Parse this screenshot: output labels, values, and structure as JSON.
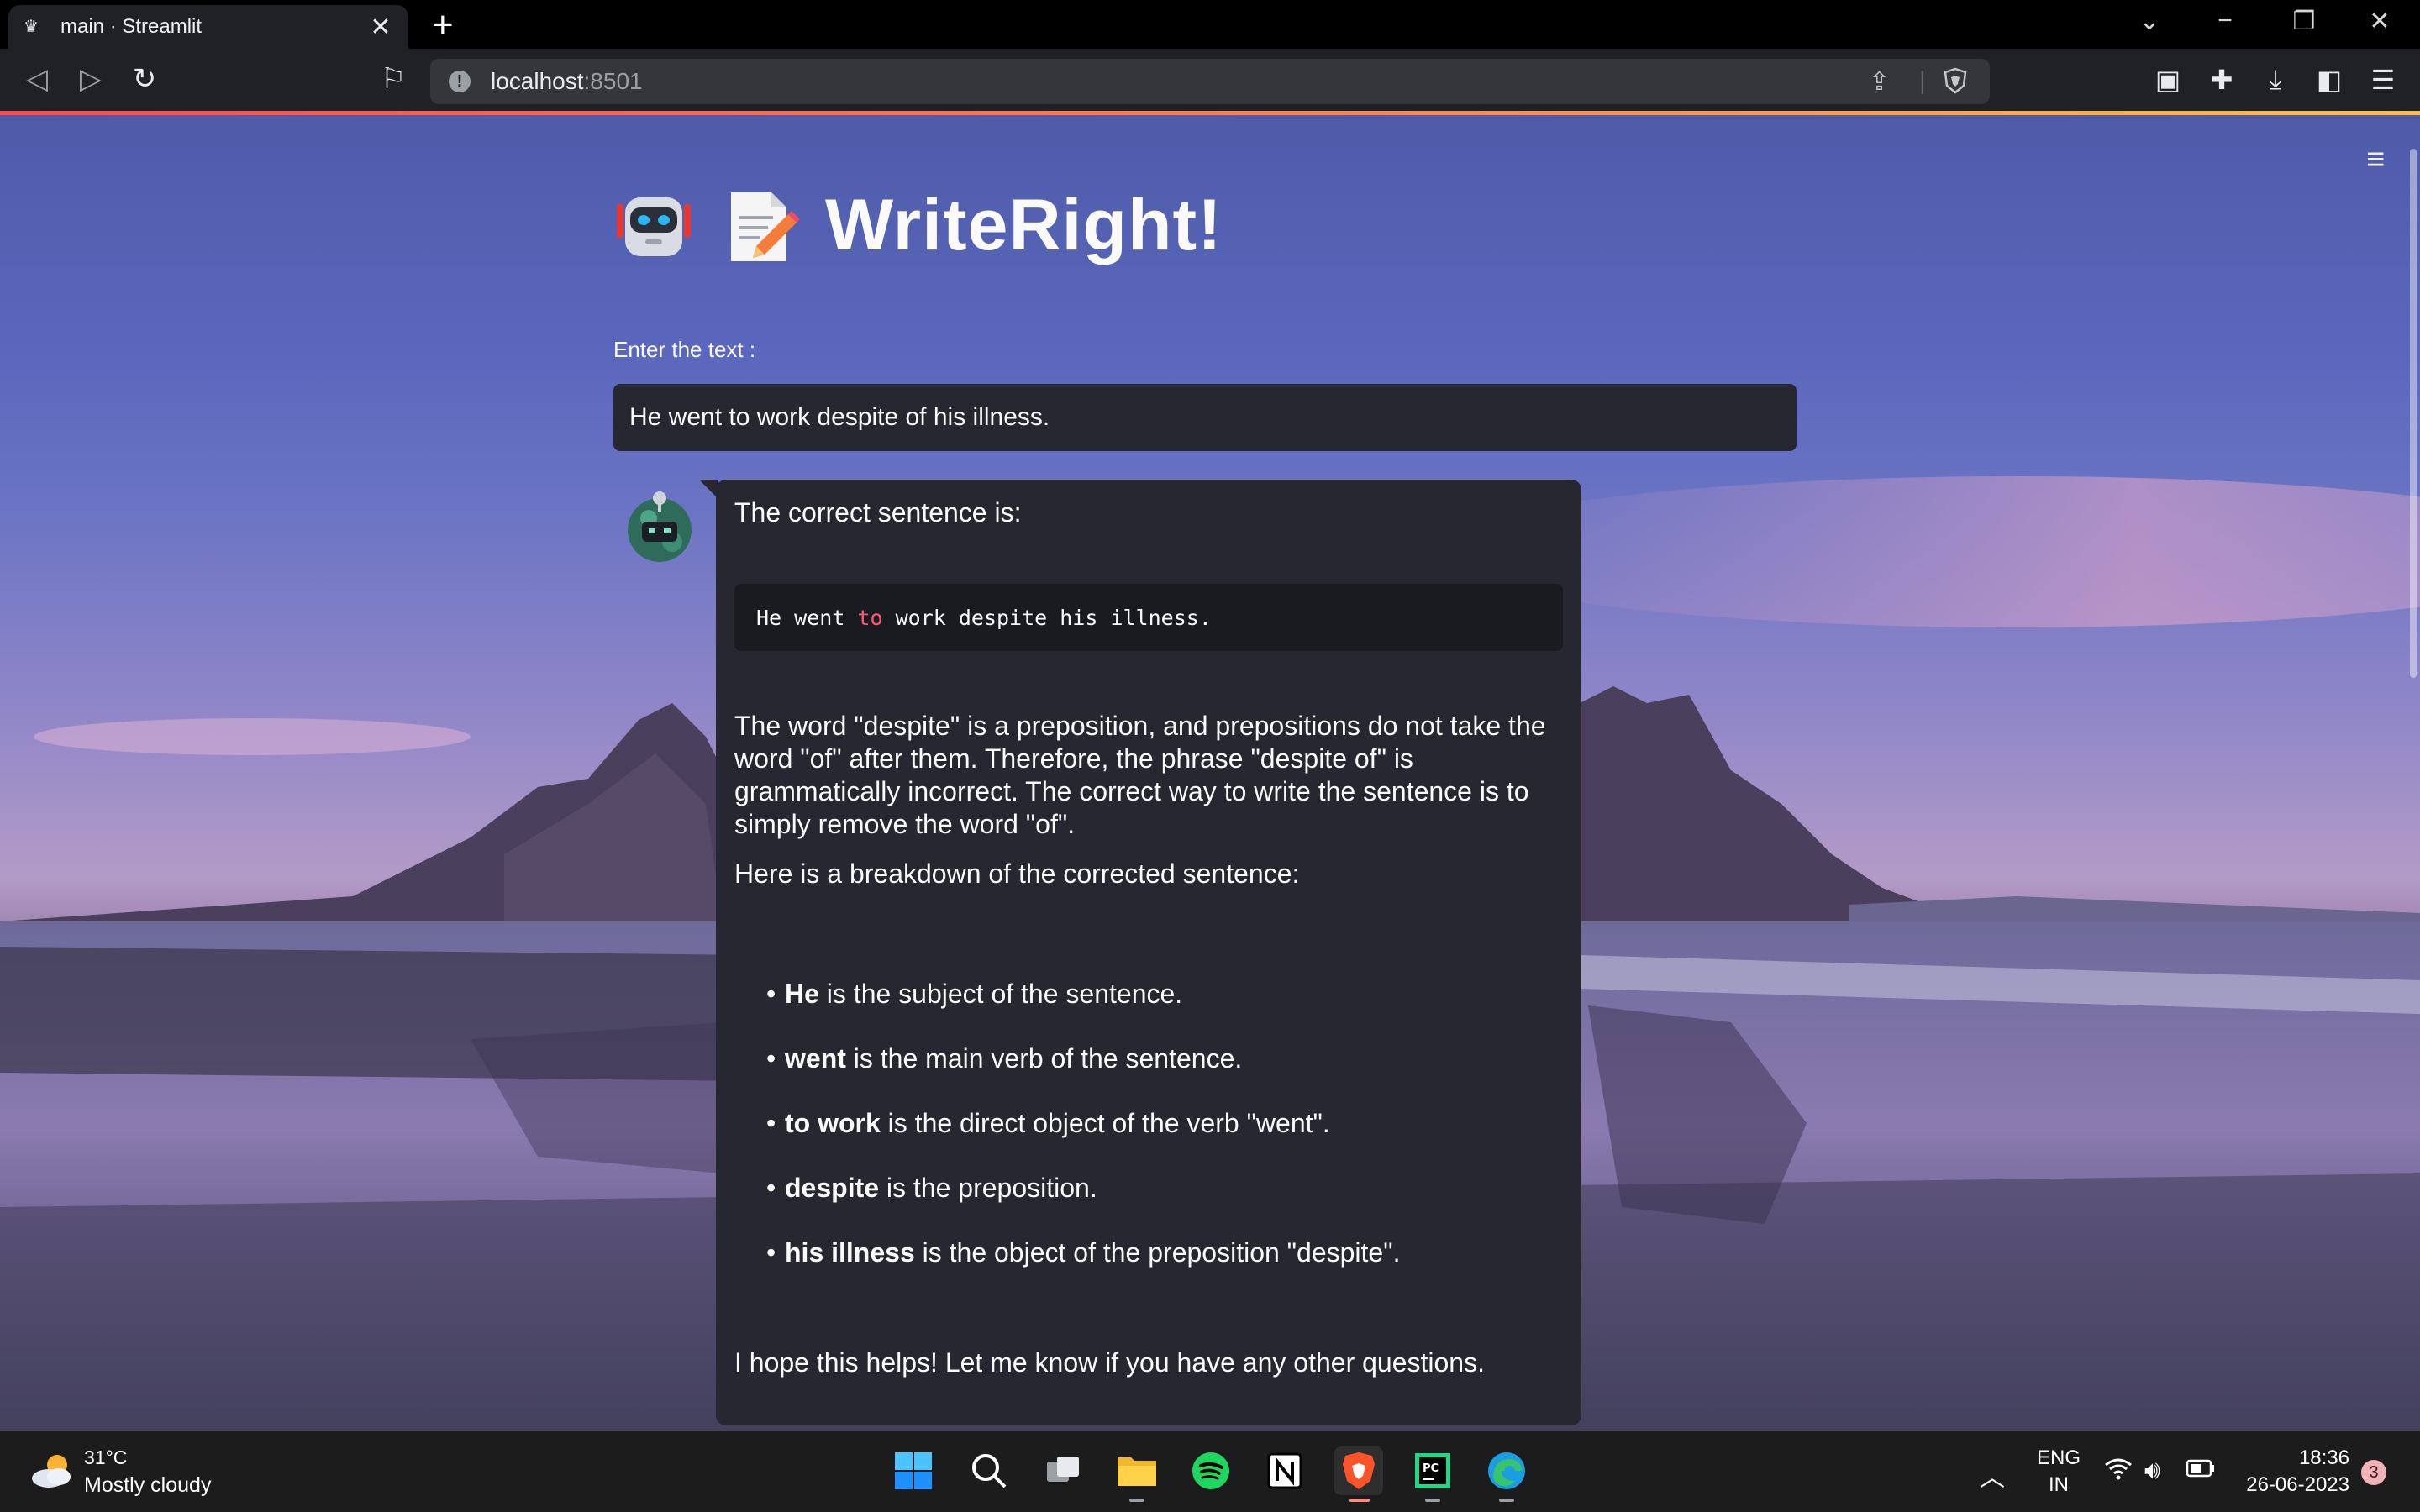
{
  "browser": {
    "tab_title": "main · Streamlit",
    "tab_close": "✕",
    "new_tab": "+",
    "url_host": "localhost",
    "url_port": ":8501"
  },
  "app": {
    "title": "WriteRight!",
    "input_label": "Enter the text :",
    "input_value": "He went to work despite of his illness."
  },
  "response": {
    "intro": "The correct sentence is:",
    "code_line": {
      "before": "He went ",
      "highlight": "to",
      "after": " work despite his illness."
    },
    "explanation": "The word \"despite\" is a preposition, and prepositions do not take the word \"of\" after them. Therefore, the phrase \"despite of\" is grammatically incorrect. The correct way to write the sentence is to simply remove the word \"of\".",
    "breakdown_intro": "Here is a breakdown of the corrected sentence:",
    "bullets": [
      {
        "term": "He",
        "text": " is the subject of the sentence."
      },
      {
        "term": "went",
        "text": " is the main verb of the sentence."
      },
      {
        "term": "to work",
        "text": " is the direct object of the verb \"went\"."
      },
      {
        "term": "despite",
        "text": " is the preposition."
      },
      {
        "term": "his illness",
        "text": " is the object of the preposition \"despite\"."
      }
    ],
    "closing": "I hope this helps! Let me know if you have any other questions."
  },
  "taskbar": {
    "weather_temp": "31°C",
    "weather_desc": "Mostly cloudy",
    "lang_line1": "ENG",
    "lang_line2": "IN",
    "time": "18:36",
    "date": "26-06-2023",
    "notification_count": "3"
  },
  "colors": {
    "streamlit_accent": "#ff4b4b",
    "bubble_bg": "#262730",
    "code_highlight": "#ff5a73"
  }
}
